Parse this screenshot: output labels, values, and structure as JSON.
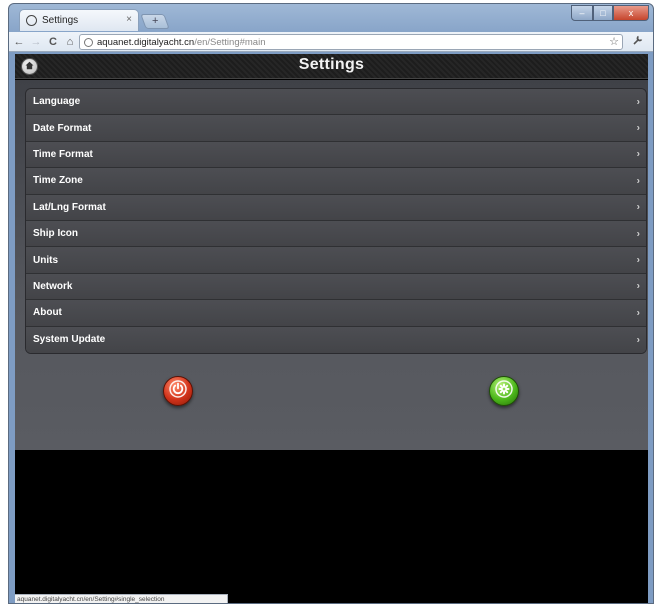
{
  "browser": {
    "tab_title": "Settings",
    "tab_close": "×",
    "new_tab": "+",
    "back": "←",
    "forward": "→",
    "reload": "C",
    "home": "⌂",
    "url_host": "aquanet.digitalyacht.cn",
    "url_path": "/en/Setting#main",
    "star": "☆",
    "menu": "🔧",
    "status_text": "aquanet.digitalyacht.cn/en/Setting#single_selection"
  },
  "window_controls": {
    "minimize": "–",
    "maximize": "□",
    "close": "x"
  },
  "header": {
    "title": "Settings"
  },
  "settings": {
    "items": [
      {
        "label": "Language"
      },
      {
        "label": "Date Format"
      },
      {
        "label": "Time Format"
      },
      {
        "label": "Time Zone"
      },
      {
        "label": "Lat/Lng Format"
      },
      {
        "label": "Ship Icon"
      },
      {
        "label": "Units"
      },
      {
        "label": "Network"
      },
      {
        "label": "About"
      },
      {
        "label": "System Update"
      }
    ],
    "chevron": "›"
  },
  "colors": {
    "power": "#d1321a",
    "reset": "#4cb81b",
    "list_bg": "#48494d",
    "page_bg": "#000000"
  },
  "icons": {
    "power": "power-icon",
    "reset": "asterisk-icon",
    "home": "home-icon"
  }
}
